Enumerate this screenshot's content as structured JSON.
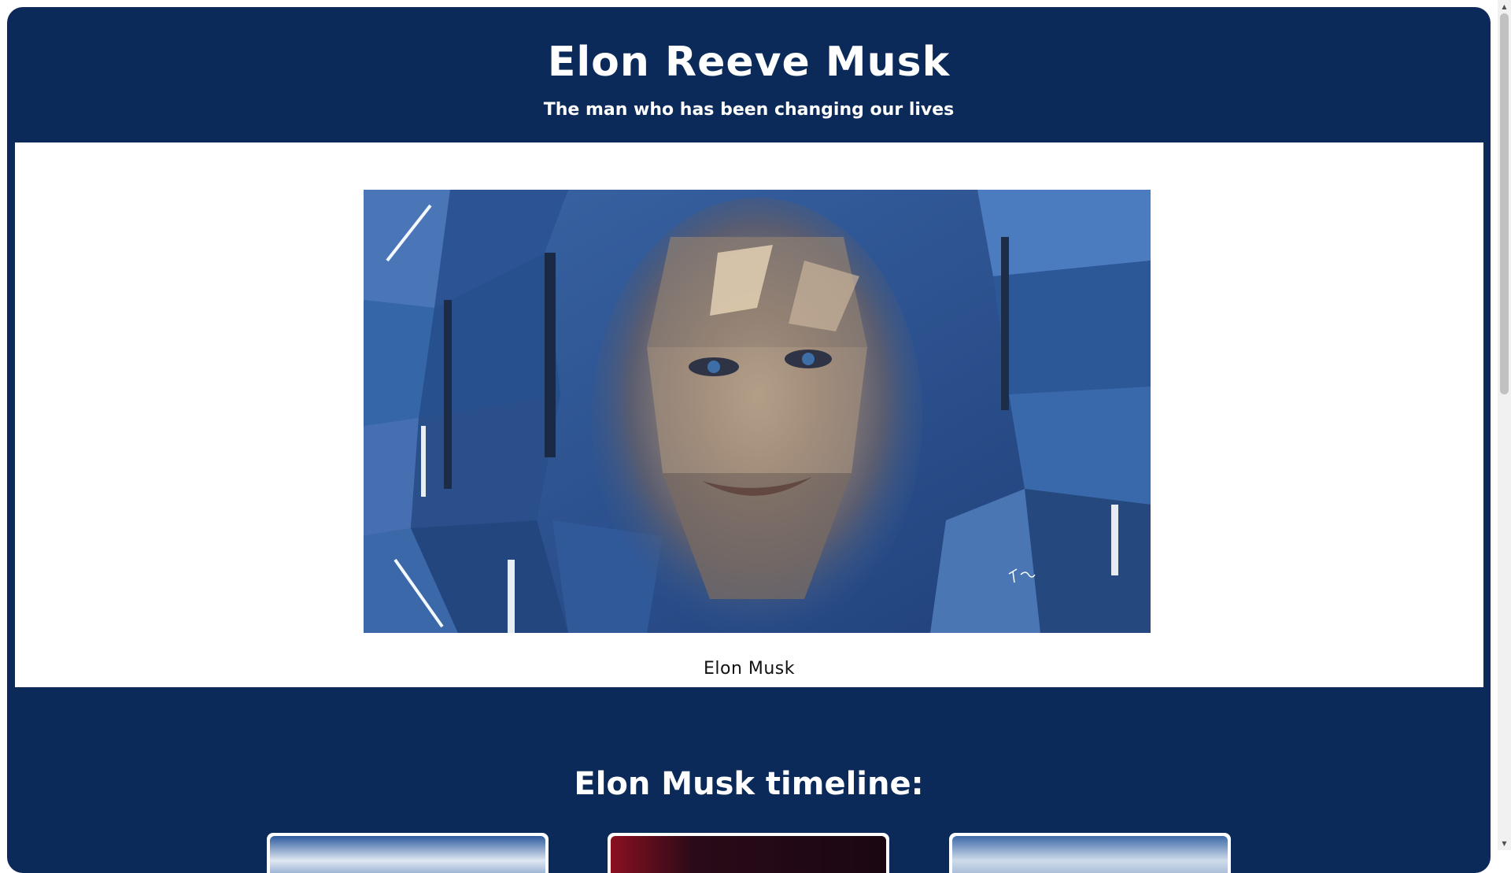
{
  "header": {
    "title": "Elon Reeve Musk",
    "subtitle": "The man who has been changing our lives"
  },
  "figure": {
    "caption": "Elon Musk",
    "image_description_icon": "mosaic-portrait-image"
  },
  "timeline": {
    "title": "Elon Musk timeline:",
    "cards": [
      {
        "icon": "rocket-launch-photo"
      },
      {
        "icon": "red-planet-photo"
      },
      {
        "icon": "launch-pad-photo"
      }
    ]
  },
  "colors": {
    "page_background": "#0b2a5a",
    "panel_background": "#ffffff",
    "text_light": "#ffffff",
    "text_dark": "#111111"
  },
  "scrollbar": {
    "up_icon": "scroll-up-arrow-icon",
    "down_icon": "scroll-down-arrow-icon"
  }
}
